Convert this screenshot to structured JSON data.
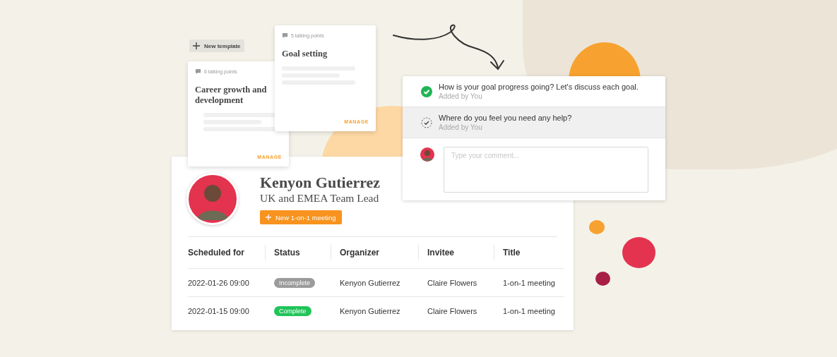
{
  "new_template_button": {
    "label": "New template"
  },
  "templates": [
    {
      "talking_points": "6 talking points",
      "title": "Career growth and development",
      "action": "MANAGE"
    },
    {
      "talking_points": "5 talking points",
      "title": "Goal setting",
      "action": "MANAGE"
    }
  ],
  "talking_points": [
    {
      "text": "How is your goal progress going? Let's discuss each goal.",
      "author": "Added by You",
      "checked": true,
      "selected": false
    },
    {
      "text": "Where do you feel you need any help?",
      "author": "Added by You",
      "checked": false,
      "selected": true
    }
  ],
  "comment": {
    "placeholder": "Type your comment..."
  },
  "profile": {
    "name": "Kenyon Gutierrez",
    "role": "UK and EMEA Team Lead",
    "button": "New 1-on-1 meeting"
  },
  "table": {
    "columns": [
      "Scheduled for",
      "Status",
      "Organizer",
      "Invitee",
      "Title"
    ],
    "rows": [
      {
        "scheduled_for": "2022-01-26 09:00",
        "status": {
          "label": "Incomplete",
          "color": "#9b9b9b"
        },
        "organizer": "Kenyon Gutierrez",
        "invitee": "Claire Flowers",
        "title": "1-on-1 meeting"
      },
      {
        "scheduled_for": "2022-01-15 09:00",
        "status": {
          "label": "Complete",
          "color": "#20c45a"
        },
        "organizer": "Kenyon Gutierrez",
        "invitee": "Claire Flowers",
        "title": "1-on-1 meeting"
      }
    ]
  }
}
